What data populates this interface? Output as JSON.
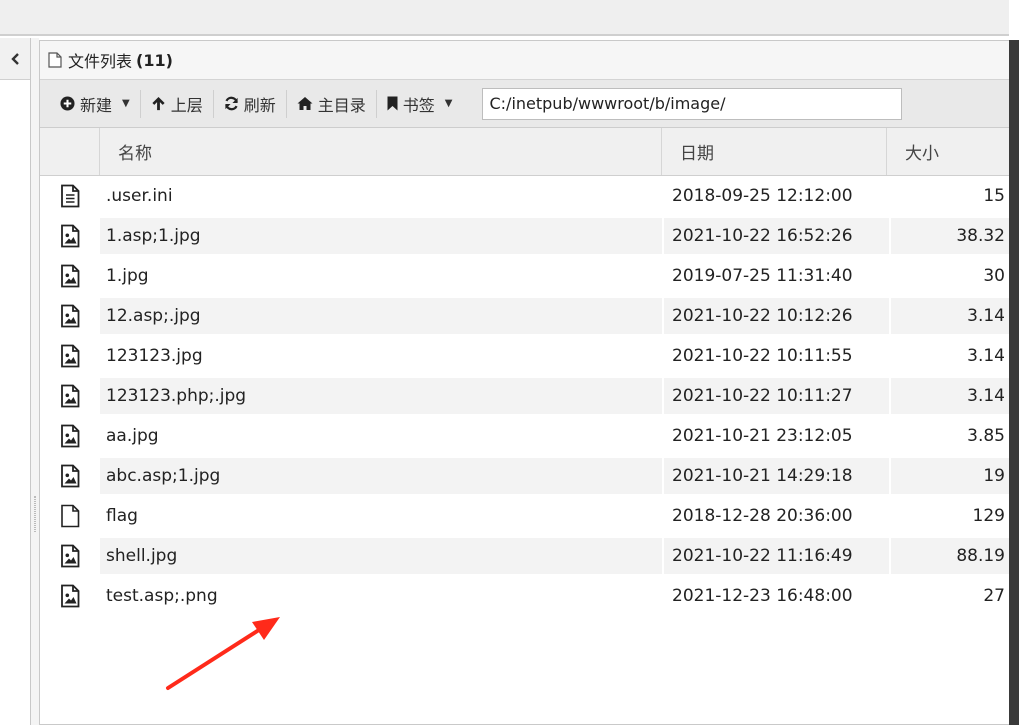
{
  "panel": {
    "title": "文件列表",
    "count": "(11)"
  },
  "toolbar": {
    "new_label": "新建",
    "up_label": "上层",
    "refresh_label": "刷新",
    "home_label": "主目录",
    "bookmark_label": "书签",
    "path_value": "C:/inetpub/wwwroot/b/image/"
  },
  "columns": {
    "name": "名称",
    "date": "日期",
    "size": "大小"
  },
  "files": [
    {
      "name": ".user.ini",
      "date": "2018-09-25 12:12:00",
      "size": "15",
      "icon": "text-file-icon"
    },
    {
      "name": "1.asp;1.jpg",
      "date": "2021-10-22 16:52:26",
      "size": "38.32",
      "icon": "image-file-icon"
    },
    {
      "name": "1.jpg",
      "date": "2019-07-25 11:31:40",
      "size": "30",
      "icon": "image-file-icon"
    },
    {
      "name": "12.asp;.jpg",
      "date": "2021-10-22 10:12:26",
      "size": "3.14",
      "icon": "image-file-icon"
    },
    {
      "name": "123123.jpg",
      "date": "2021-10-22 10:11:55",
      "size": "3.14",
      "icon": "image-file-icon"
    },
    {
      "name": "123123.php;.jpg",
      "date": "2021-10-22 10:11:27",
      "size": "3.14",
      "icon": "image-file-icon"
    },
    {
      "name": "aa.jpg",
      "date": "2021-10-21 23:12:05",
      "size": "3.85",
      "icon": "image-file-icon"
    },
    {
      "name": "abc.asp;1.jpg",
      "date": "2021-10-21 14:29:18",
      "size": "19",
      "icon": "image-file-icon"
    },
    {
      "name": "flag",
      "date": "2018-12-28 20:36:00",
      "size": "129",
      "icon": "blank-file-icon"
    },
    {
      "name": "shell.jpg",
      "date": "2021-10-22 11:16:49",
      "size": "88.19",
      "icon": "image-file-icon"
    },
    {
      "name": "test.asp;.png",
      "date": "2021-12-23 16:48:00",
      "size": "27",
      "icon": "image-file-icon"
    }
  ],
  "colors": {
    "annotation_arrow": "#ff2a1a"
  }
}
